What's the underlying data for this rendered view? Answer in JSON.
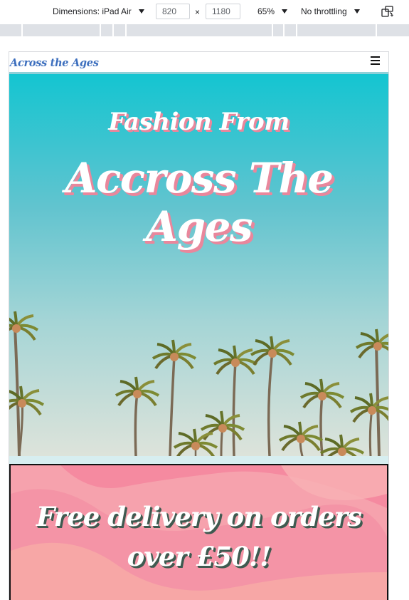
{
  "devtools": {
    "dimensions_label": "Dimensions: iPad Air",
    "width_value": "820",
    "times": "×",
    "height_value": "1180",
    "zoom": "65%",
    "throttling": "No throttling",
    "rotate_icon": "rotate-device-icon"
  },
  "site": {
    "brand": "Across the Ages",
    "menu_icon": "hamburger-menu-icon",
    "hero": {
      "title_small": "Fashion From",
      "title_big": "Accross The Ages"
    },
    "promo": {
      "text": "Free delivery on orders over £50!!"
    }
  },
  "colors": {
    "brand": "#3d6fbe",
    "title_shadow": "#e9879c",
    "promo_bg": "#f6a2ad",
    "promo_shadow": "#3f5a50",
    "sky_top": "#14c5d1",
    "sky_bottom": "#dde3da"
  }
}
